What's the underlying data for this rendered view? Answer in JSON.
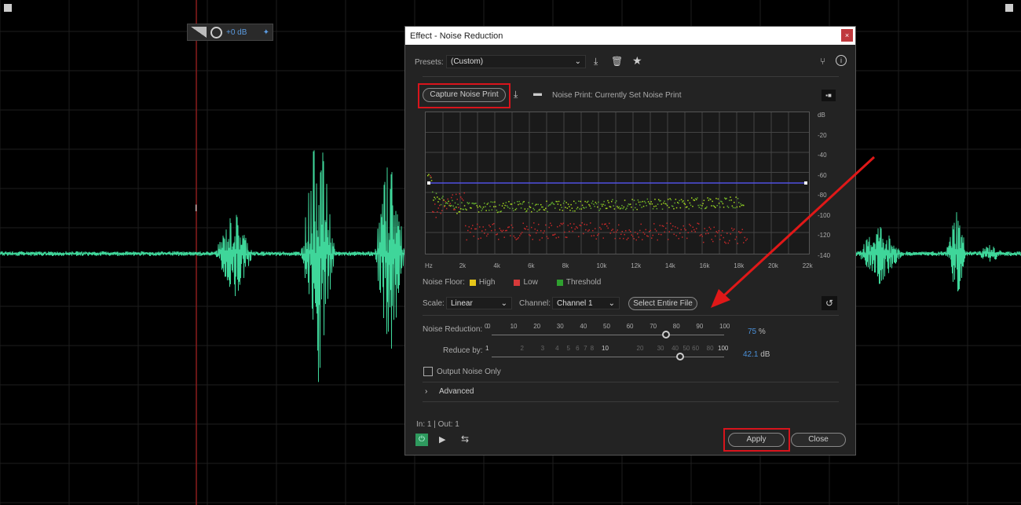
{
  "hud": {
    "volume": "+0 dB"
  },
  "dialog": {
    "title": "Effect - Noise Reduction",
    "close_x": "×",
    "presets_label": "Presets:",
    "preset_value": "(Custom)",
    "capture_label": "Capture Noise Print",
    "noise_print": "Noise Print: Currently Set Noise Print",
    "db_labels": [
      "dB",
      "-20",
      "-40",
      "-60",
      "-80",
      "-100",
      "-120",
      "-140"
    ],
    "hz_labels": [
      "Hz",
      "2k",
      "4k",
      "6k",
      "8k",
      "10k",
      "12k",
      "14k",
      "16k",
      "18k",
      "20k",
      "22k"
    ],
    "legend_label": "Noise Floor:",
    "legend": [
      {
        "label": "High",
        "color": "#e6c619"
      },
      {
        "label": "Low",
        "color": "#d63a3a"
      },
      {
        "label": "Threshold",
        "color": "#2fa02f"
      }
    ],
    "scale_label": "Scale:",
    "scale_value": "Linear",
    "channel_label": "Channel:",
    "channel_value": "Channel 1",
    "select_file": "Select Entire File",
    "nr_label": "Noise Reduction:",
    "nr_ticks": [
      "0",
      "0",
      "10",
      "20",
      "30",
      "40",
      "50",
      "60",
      "70",
      "80",
      "90",
      "100"
    ],
    "nr_value": "75",
    "nr_unit": "%",
    "nr_percent": 75,
    "rb_label": "Reduce by:",
    "rb_ticks": [
      "1",
      "2",
      "3",
      "4",
      "5",
      "6",
      "7",
      "8",
      "10",
      "20",
      "30",
      "40",
      "50",
      "60",
      "80",
      "100"
    ],
    "rb_value": "42.1",
    "rb_unit": "dB",
    "output_noise": "Output Noise Only",
    "output_noise_checked": false,
    "advanced": "Advanced",
    "io": "In: 1 | Out: 1",
    "apply": "Apply",
    "close": "Close",
    "accent": "#4a90d9",
    "highlight": "#d8141c"
  }
}
